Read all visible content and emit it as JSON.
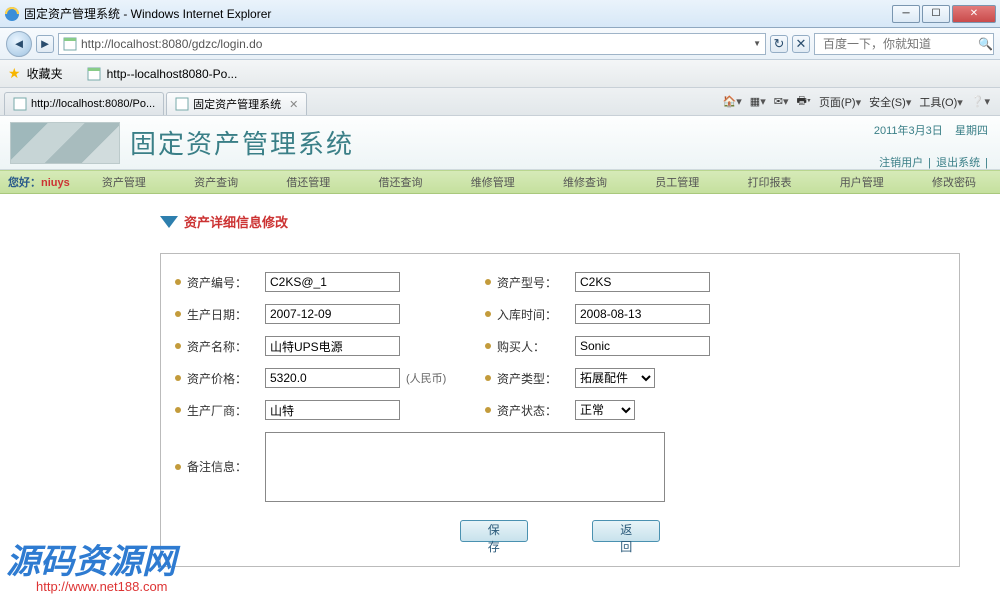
{
  "window": {
    "title": "固定资产管理系统 - Windows Internet Explorer"
  },
  "address": {
    "url": "http://localhost:8080/gdzc/login.do",
    "search_placeholder": "百度一下，你就知道"
  },
  "favbar": {
    "label": "收藏夹",
    "item1": "http--localhost8080-Po..."
  },
  "tabs": {
    "t1": "http://localhost:8080/Po...",
    "t2": "固定资产管理系统"
  },
  "cmdbar": {
    "page": "页面(P)",
    "safety": "安全(S)",
    "tools": "工具(O)"
  },
  "header": {
    "title": "固定资产管理系统",
    "date": "2011年3月3日",
    "weekday": "星期四",
    "reg": "注销用户",
    "exit": "退出系统"
  },
  "menu": {
    "greet": "您好：",
    "user": "niuys",
    "items": [
      "资产管理",
      "资产查询",
      "借还管理",
      "借还查询",
      "维修管理",
      "维修查询",
      "员工管理",
      "打印报表",
      "用户管理",
      "修改密码"
    ]
  },
  "section": {
    "title": "资产详细信息修改"
  },
  "form": {
    "asset_no_label": "资产编号：",
    "asset_no": "C2KS@_1",
    "asset_model_label": "资产型号：",
    "asset_model": "C2KS",
    "prod_date_label": "生产日期：",
    "prod_date": "2007-12-09",
    "in_date_label": "入库时间：",
    "in_date": "2008-08-13",
    "asset_name_label": "资产名称：",
    "asset_name": "山特UPS电源",
    "buyer_label": "购买人：",
    "buyer": "Sonic",
    "price_label": "资产价格：",
    "price": "5320.0",
    "price_unit": "(人民币)",
    "type_label": "资产类型：",
    "type": "拓展配件",
    "manuf_label": "生产厂商：",
    "manuf": "山特",
    "status_label": "资产状态：",
    "status": "正常",
    "remark_label": "备注信息：",
    "remark": ""
  },
  "buttons": {
    "save": "保 存",
    "back": "返 回"
  },
  "watermark": {
    "name": "源码资源网",
    "url": "http://www.net188.com"
  }
}
